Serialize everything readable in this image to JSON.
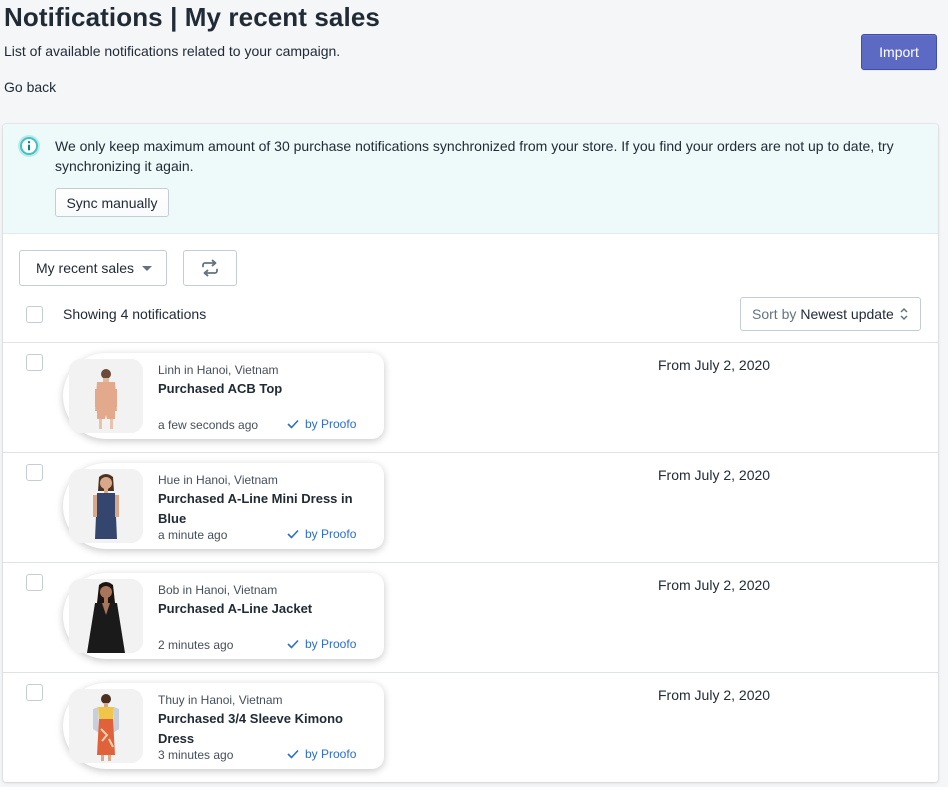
{
  "header": {
    "title": "Notifications | My recent sales",
    "subtitle": "List of available notifications related to your campaign.",
    "go_back": "Go back",
    "import_label": "Import"
  },
  "banner": {
    "message": "We only keep maximum amount of 30 purchase notifications synchronized from your store. If you find your orders are not up to date, try synchronizing it again.",
    "sync_label": "Sync manually",
    "icon": "info-icon"
  },
  "toolbar": {
    "dropdown_label": "My recent sales",
    "refresh_icon": "refresh-icon",
    "showing": "Showing 4 notifications",
    "sort_prefix": "Sort by",
    "sort_value": "Newest update"
  },
  "notifications": [
    {
      "location": "Linh in Hanoi, Vietnam",
      "title": "Purchased ACB Top",
      "time": "a few seconds ago",
      "by": "by Proofo",
      "date": "From July 2, 2020",
      "image": "product-photo-peach-top"
    },
    {
      "location": "Hue in Hanoi, Vietnam",
      "title": "Purchased A-Line Mini Dress in Blue",
      "time": "a minute ago",
      "by": "by Proofo",
      "date": "From July 2, 2020",
      "image": "product-photo-blue-dress"
    },
    {
      "location": "Bob in Hanoi, Vietnam",
      "title": "Purchased A-Line Jacket",
      "time": "2 minutes ago",
      "by": "by Proofo",
      "date": "From July 2, 2020",
      "image": "product-photo-black-jacket"
    },
    {
      "location": "Thuy in Hanoi, Vietnam",
      "title": "Purchased 3/4 Sleeve Kimono Dress",
      "time": "3 minutes ago",
      "by": "by Proofo",
      "date": "From July 2, 2020",
      "image": "product-photo-kimono-dress"
    }
  ],
  "colors": {
    "primary_button": "#5c6ac4",
    "banner_bg": "#eef9f9",
    "info_icon": "#47c1bf",
    "link_blue": "#2c6ecb",
    "page_bg": "#f4f6f8"
  }
}
